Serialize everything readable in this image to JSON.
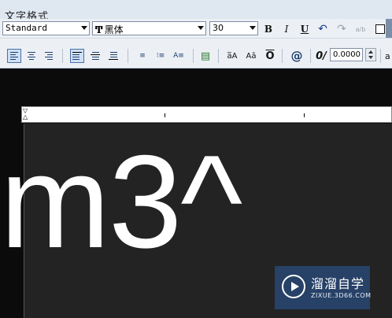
{
  "window": {
    "title": "文字格式"
  },
  "toolbar1": {
    "style_value": "Standard",
    "font_icon_glyph": "Ͳ",
    "font_value": "黑体",
    "height_value": "30",
    "bold_label": "B",
    "italic_label": "I",
    "underline_label": "U",
    "undo_glyph": "↶",
    "redo_glyph": "↷",
    "stack_glyph": "a/b",
    "color_label": ""
  },
  "toolbar2": {
    "upper_label": "a̅A",
    "lower_label": "Aā",
    "overline_label": "O",
    "symbol_label": "@",
    "oblique_label": "0/",
    "oblique_value": "0.0000",
    "tracking_label": "a"
  },
  "editor": {
    "text": "m3^"
  },
  "watermark": {
    "name": "溜溜自学",
    "url": "ZIXUE.3D66.COM"
  }
}
